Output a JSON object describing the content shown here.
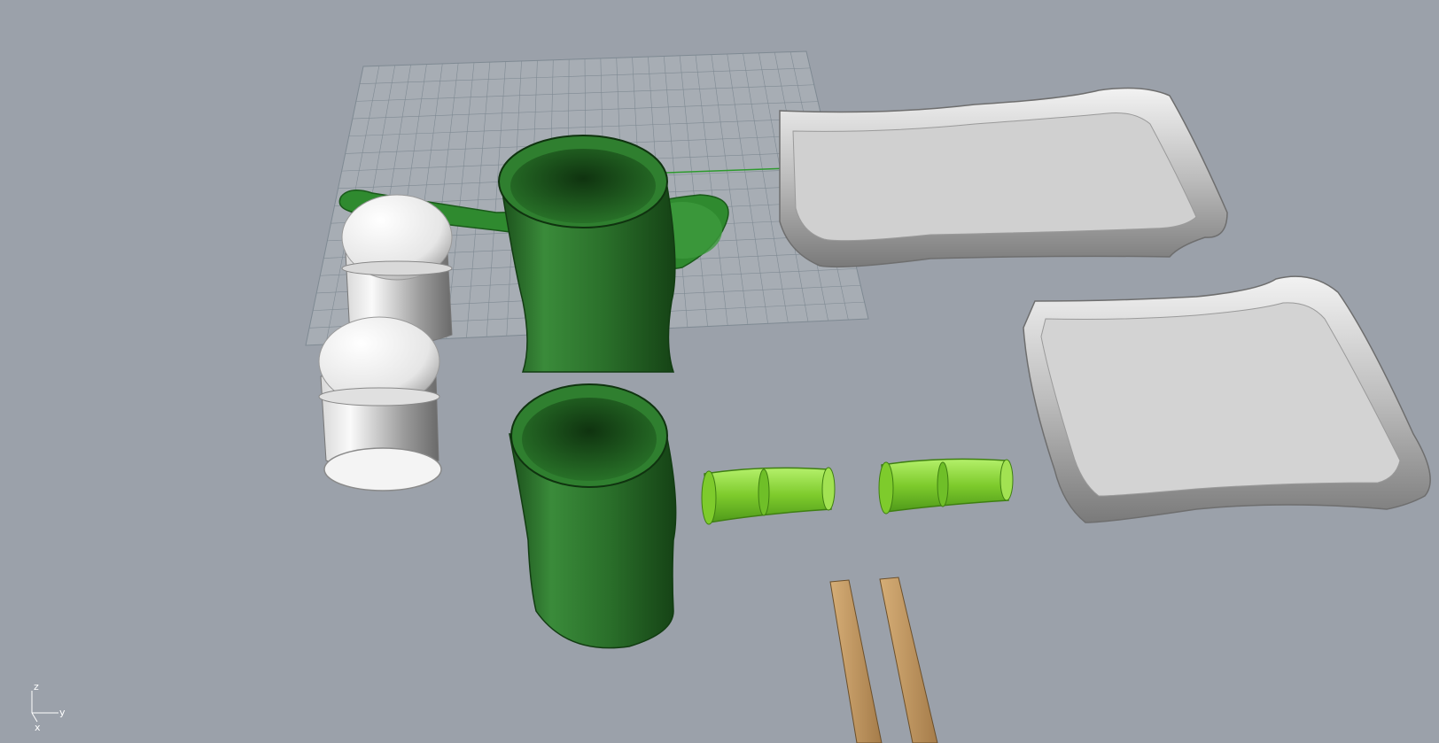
{
  "viewport": {
    "background": "#9ba1aa",
    "grid_color": "#7f8a93",
    "axis_line_color": "#2e9a2e"
  },
  "axis_gizmo": {
    "z": "z",
    "y": "y",
    "x": "x"
  },
  "objects": [
    {
      "name": "cup",
      "material": "green",
      "count": 2
    },
    {
      "name": "spoon",
      "material": "green",
      "count": 1
    },
    {
      "name": "shaker",
      "material": "white",
      "count": 2
    },
    {
      "name": "tray",
      "material": "silver",
      "count": 2
    },
    {
      "name": "chopstick-rest",
      "material": "lime",
      "count": 2
    },
    {
      "name": "chopstick",
      "material": "wood",
      "count": 2
    }
  ],
  "colors": {
    "green_dark": "#1f5a1f",
    "green": "#2f7f2f",
    "lime": "#8fd13a",
    "white": "#f2f2f2",
    "silver": "#cfcfcf",
    "wood": "#c39a65"
  }
}
